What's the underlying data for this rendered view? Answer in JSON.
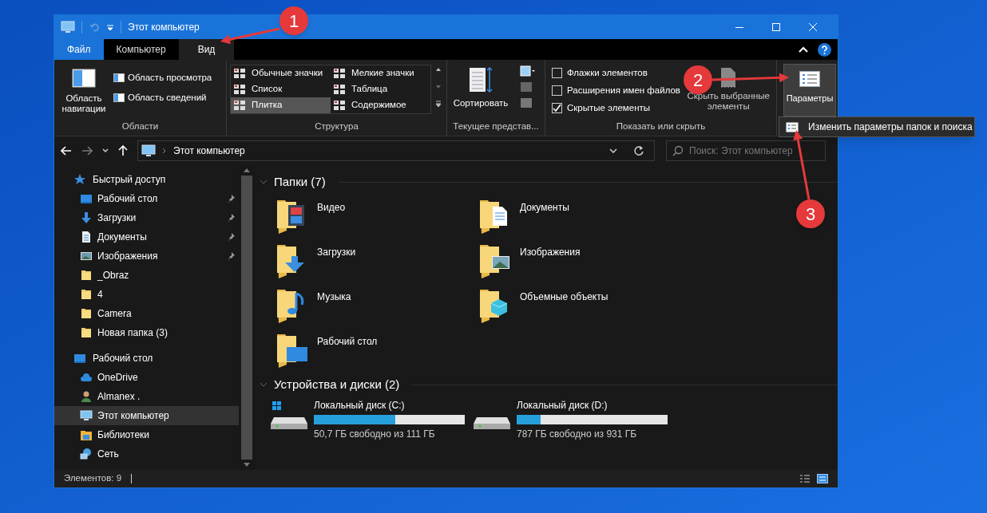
{
  "window": {
    "title": "Этот компьютер"
  },
  "tabs": [
    {
      "label": "Файл",
      "kind": "file",
      "selected": false
    },
    {
      "label": "Компьютер",
      "kind": "tab",
      "selected": false
    },
    {
      "label": "Вид",
      "kind": "tab",
      "selected": true
    }
  ],
  "ribbon": {
    "panes": {
      "label": "Области",
      "big_button": "Область\nнавигации",
      "small_buttons": [
        "Область просмотра",
        "Область сведений"
      ]
    },
    "layout": {
      "label": "Структура",
      "options": [
        {
          "label": "Обычные значки",
          "selected": false
        },
        {
          "label": "Мелкие значки",
          "selected": false
        },
        {
          "label": "Список",
          "selected": false
        },
        {
          "label": "Таблица",
          "selected": false
        },
        {
          "label": "Плитка",
          "selected": true
        },
        {
          "label": "Содержимое",
          "selected": false
        }
      ]
    },
    "current_view": {
      "label": "Текущее представ...",
      "button": "Сортировать"
    },
    "show_hide": {
      "label": "Показать или скрыть",
      "checkboxes": [
        {
          "label": "Флажки элементов",
          "checked": false
        },
        {
          "label": "Расширения имен файлов",
          "checked": false
        },
        {
          "label": "Скрытые элементы",
          "checked": true
        }
      ],
      "button": "Скрыть выбранные\nэлементы"
    },
    "options": {
      "button": "Параметры",
      "menu_item": "Изменить параметры папок и поиска"
    }
  },
  "address": {
    "path": "Этот компьютер",
    "search_placeholder": "Поиск: Этот компьютер"
  },
  "nav": [
    {
      "label": "Быстрый доступ",
      "kind": "star",
      "selected": false,
      "children": [
        {
          "label": "Рабочий стол",
          "kind": "desktop",
          "pinned": true,
          "selected": false
        },
        {
          "label": "Загрузки",
          "kind": "download",
          "pinned": true,
          "selected": false
        },
        {
          "label": "Документы",
          "kind": "document",
          "pinned": true,
          "selected": false
        },
        {
          "label": "Изображения",
          "kind": "picture",
          "pinned": true,
          "selected": false
        },
        {
          "label": "_Obraz",
          "kind": "folder",
          "pinned": false,
          "selected": false
        },
        {
          "label": "4",
          "kind": "folder",
          "pinned": false,
          "selected": false
        },
        {
          "label": "Camera",
          "kind": "folder",
          "pinned": false,
          "selected": false
        },
        {
          "label": "Новая папка (3)",
          "kind": "folder",
          "pinned": false,
          "selected": false
        }
      ]
    },
    {
      "label": "Рабочий стол",
      "kind": "desktop",
      "selected": false,
      "children": [
        {
          "label": "OneDrive",
          "kind": "cloud",
          "pinned": false,
          "selected": false
        },
        {
          "label": "Almanex .",
          "kind": "user",
          "pinned": false,
          "selected": false
        },
        {
          "label": "Этот компьютер",
          "kind": "computer",
          "pinned": false,
          "selected": true
        },
        {
          "label": "Библиотеки",
          "kind": "library",
          "pinned": false,
          "selected": false
        },
        {
          "label": "Сеть",
          "kind": "network",
          "pinned": false,
          "selected": false
        }
      ]
    }
  ],
  "folders": {
    "heading": "Папки (7)",
    "items": [
      {
        "label": "Видео",
        "kind": "video"
      },
      {
        "label": "Документы",
        "kind": "documents"
      },
      {
        "label": "Загрузки",
        "kind": "downloads"
      },
      {
        "label": "Изображения",
        "kind": "pictures"
      },
      {
        "label": "Музыка",
        "kind": "music"
      },
      {
        "label": "Объемные объекты",
        "kind": "objects"
      },
      {
        "label": "Рабочий стол",
        "kind": "desktop"
      }
    ]
  },
  "drives": {
    "heading": "Устройства и диски (2)",
    "items": [
      {
        "label": "Локальный диск (C:)",
        "kind": "system",
        "level": 0.54,
        "free": "50,7 ГБ свободно из 111 ГБ"
      },
      {
        "label": "Локальный диск (D:)",
        "kind": "plain",
        "level": 0.16,
        "free": "787 ГБ свободно из 931 ГБ"
      }
    ]
  },
  "status_bar": {
    "items": "Элементов: 9"
  },
  "annotations": [
    {
      "label": "1"
    },
    {
      "label": "2"
    },
    {
      "label": "3"
    }
  ]
}
